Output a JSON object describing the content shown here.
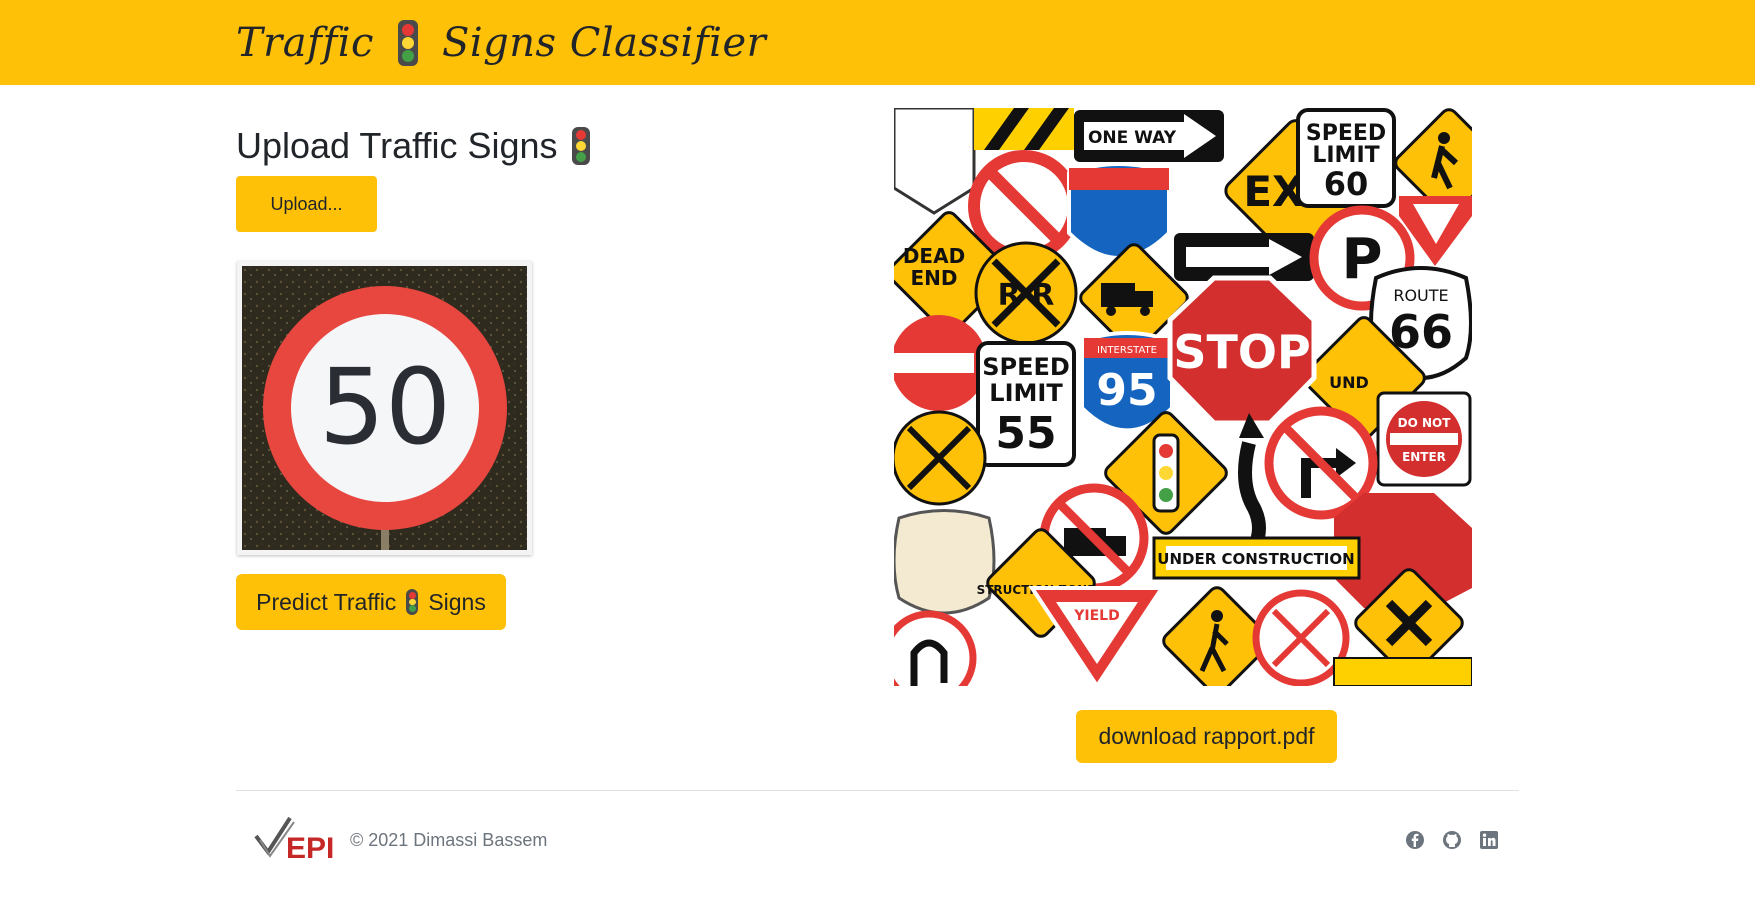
{
  "navbar": {
    "brand_left": "Traffic",
    "brand_right": "Signs Classifier",
    "icon": "traffic-light-icon"
  },
  "upload": {
    "title": "Upload Traffic Signs",
    "button_label": "Upload..."
  },
  "preview": {
    "sign_text": "50"
  },
  "predict": {
    "label_left": "Predict Traffic",
    "label_right": "Signs"
  },
  "collage": {
    "texts": {
      "one_way": "ONE WAY",
      "speed_limit_60a": "SPEED",
      "speed_limit_60b": "LIMIT",
      "speed_limit_60c": "60",
      "exit": "EXIT",
      "dead_end_a": "DEAD",
      "dead_end_b": "END",
      "rr": "R  R",
      "p": "P",
      "route": "ROUTE",
      "route_num": "66",
      "stop": "STOP",
      "interstate": "INTERSTATE",
      "interstate_num": "95",
      "speed_limit_55a": "SPEED",
      "speed_limit_55b": "LIMIT",
      "speed_limit_55c": "55",
      "do_not": "DO NOT",
      "enter": "ENTER",
      "under_construction": "UNDER CONSTRUCTION",
      "yield": "YIELD",
      "construction_zone": "STRUCTION ZONE",
      "und": "UND"
    }
  },
  "download": {
    "label": "download rapport.pdf"
  },
  "footer": {
    "logo_text": "EPI",
    "copyright": "© 2021 Dimassi Bassem",
    "icons": [
      "facebook-icon",
      "github-icon",
      "linkedin-icon"
    ]
  },
  "colors": {
    "accent": "#ffc107",
    "text": "#212529",
    "muted": "#6c757d",
    "divider": "#dee2e6"
  }
}
